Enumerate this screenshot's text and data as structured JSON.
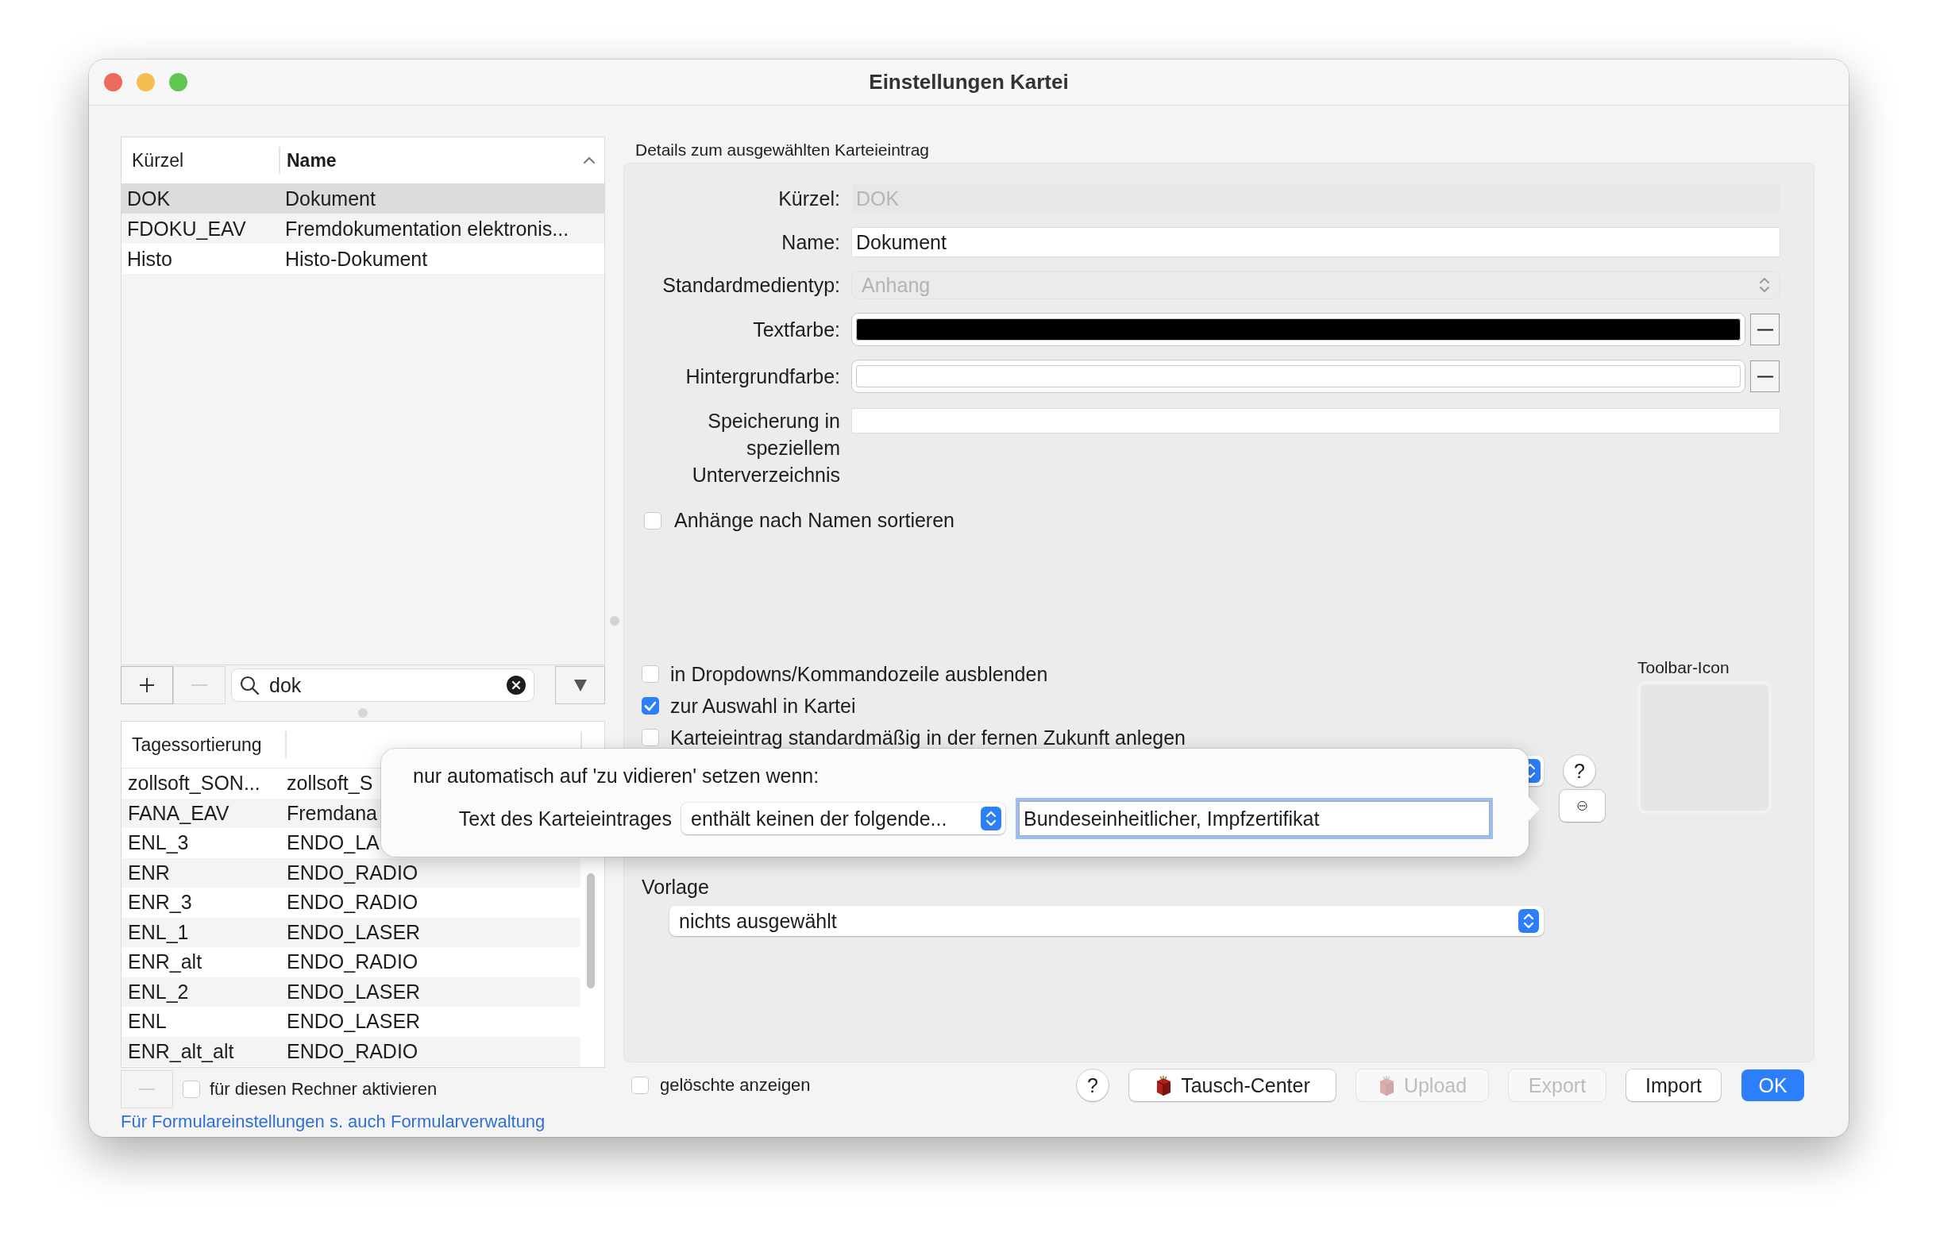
{
  "window": {
    "title": "Einstellungen Kartei"
  },
  "entries_table": {
    "columns": [
      {
        "label": "Kürzel",
        "sorted": false
      },
      {
        "label": "Name",
        "sorted": true
      }
    ],
    "rows": [
      {
        "cells": [
          "DOK",
          "Dokument"
        ],
        "selected": true
      },
      {
        "cells": [
          "FDOKU_EAV",
          "Fremdokumentation elektronis..."
        ],
        "selected": false
      },
      {
        "cells": [
          "Histo",
          "Histo-Dokument"
        ],
        "selected": false
      }
    ]
  },
  "entries_toolbar": {
    "add_button": {
      "disabled": false
    },
    "remove_button": {
      "disabled": true
    },
    "search": {
      "value": "dok"
    }
  },
  "sort_table": {
    "columns": [
      "Tagessortierung"
    ],
    "rows": [
      {
        "cells": [
          "zollsoft_SON...",
          "zollsoft_S"
        ]
      },
      {
        "cells": [
          "FANA_EAV",
          "Fremdana"
        ]
      },
      {
        "cells": [
          "ENL_3",
          "ENDO_LA"
        ]
      },
      {
        "cells": [
          "ENR",
          "ENDO_RADIO"
        ]
      },
      {
        "cells": [
          "ENR_3",
          "ENDO_RADIO"
        ]
      },
      {
        "cells": [
          "ENL_1",
          "ENDO_LASER"
        ]
      },
      {
        "cells": [
          "ENR_alt",
          "ENDO_RADIO"
        ]
      },
      {
        "cells": [
          "ENL_2",
          "ENDO_LASER"
        ]
      },
      {
        "cells": [
          "ENL",
          "ENDO_LASER"
        ]
      },
      {
        "cells": [
          "ENR_alt_alt",
          "ENDO_RADIO"
        ]
      }
    ]
  },
  "sort_footer": {
    "remove_button": {
      "disabled": true
    },
    "activate": {
      "label": "für diesen Rechner aktivieren",
      "checked": false
    },
    "link": "Für Formulareinstellungen s. auch Formularverwaltung"
  },
  "details": {
    "title": "Details zum ausgewählten Karteieintrag",
    "fields": [
      {
        "kind": "text",
        "label": "Kürzel:",
        "value": "DOK",
        "disabled": true
      },
      {
        "kind": "text",
        "label": "Name:",
        "value": "Dokument",
        "disabled": false
      },
      {
        "kind": "select",
        "label": "Standardmedientyp:",
        "value": "Anhang",
        "disabled": true
      },
      {
        "kind": "color",
        "label": "Textfarbe:",
        "color": "#000000"
      },
      {
        "kind": "color",
        "label": "Hintergrundfarbe:",
        "color": "#ffffff"
      },
      {
        "kind": "text",
        "label": "Speicherung in speziellem Unterverzeichnis",
        "disabled": false
      }
    ],
    "sort_attachments": {
      "label": "Anhänge nach Namen sortieren",
      "checked": false
    },
    "options": [
      {
        "label": "in Dropdowns/Kommandozeile ausblenden",
        "checked": false
      },
      {
        "label": "zur Auswahl in Kartei",
        "checked": true
      },
      {
        "label": "Karteieintrag standardmäßig in der fernen Zukunft anlegen",
        "checked": false
      }
    ],
    "help_button": "?",
    "template": {
      "label": "Vorlage",
      "value": "nichts ausgewählt"
    },
    "toolbar_icon": {
      "label": "Toolbar-Icon"
    }
  },
  "popover": {
    "title": "nur automatisch auf 'zu vidieren' setzen wenn:",
    "condition_label": "Text des Karteieintrages",
    "operator": "enthält keinen der folgende...",
    "value": "Bundeseinheitlicher, Impfzertifikat"
  },
  "footer": {
    "show_deleted": {
      "label": "gelöschte anzeigen",
      "checked": false
    },
    "help_button": "?",
    "buttons": [
      {
        "label": "Tausch-Center",
        "kind": "icon",
        "disabled": false
      },
      {
        "label": "Upload",
        "kind": "icon",
        "disabled": true
      },
      {
        "label": "Export",
        "kind": "plain",
        "disabled": true
      },
      {
        "label": "Import",
        "kind": "plain",
        "disabled": false
      },
      {
        "label": "OK",
        "kind": "default",
        "disabled": false
      }
    ]
  }
}
